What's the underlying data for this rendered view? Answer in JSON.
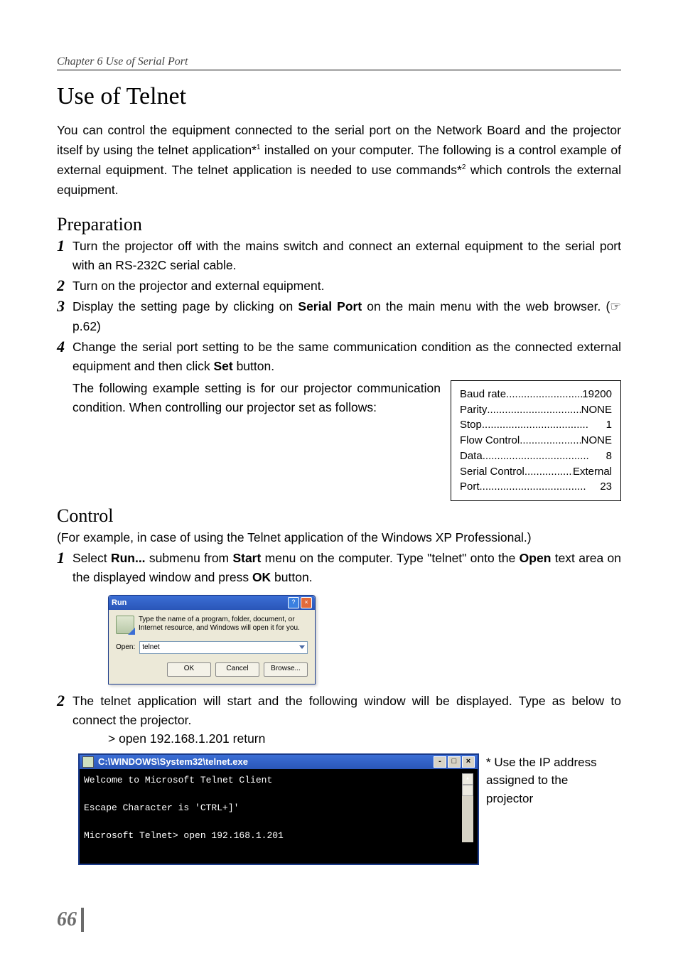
{
  "chapter_header": "Chapter 6 Use of Serial Port",
  "title": "Use of Telnet",
  "intro": {
    "p1a": "You can control the equipment connected to the serial port on the Network Board and the projector itself by using the telnet application*",
    "sup1": "1",
    "p1b": " installed on your computer. The following is a control example of external equipment. The telnet application is needed to use commands*",
    "sup2": "2",
    "p1c": " which controls the external equipment."
  },
  "prep_heading": "Preparation",
  "prep": {
    "s1": "Turn the projector off with the mains switch and connect an external equipment to the serial port with an RS-232C serial cable.",
    "s2": "Turn on the projector and external equipment.",
    "s3a": "Display the setting page by clicking on ",
    "s3b": "Serial Port",
    "s3c": " on the main menu with the web browser. (☞ p.62)",
    "s4a": "Change the serial port setting to be the same communication condition as the connected external equipment and then click ",
    "s4b": "Set",
    "s4c": " button.",
    "s4_follow": "The following example setting is for our projector communication condition. When controlling our projector set as follows:"
  },
  "settings": [
    {
      "k": "Baud rate",
      "v": "19200"
    },
    {
      "k": "Parity",
      "v": "NONE"
    },
    {
      "k": "Stop",
      "v": "1"
    },
    {
      "k": "Flow Control",
      "v": "NONE"
    },
    {
      "k": "Data",
      "v": "8"
    },
    {
      "k": "Serial Control",
      "v": "External"
    },
    {
      "k": "Port",
      "v": "23"
    }
  ],
  "control_heading": "Control",
  "control_note": "(For example, in case of using the Telnet application of the Windows XP Professional.)",
  "control": {
    "s1a": "Select ",
    "s1b": "Run...",
    "s1c": " submenu from ",
    "s1d": "Start",
    "s1e": " menu on the computer. Type \"telnet\" onto the ",
    "s1f": "Open",
    "s1g": " text area on the displayed window and press ",
    "s1h": "OK",
    "s1i": " button.",
    "s2": "The telnet application will start and the following window will be displayed. Type as below to connect the projector.",
    "cmd": "> open 192.168.1.201 return"
  },
  "run_dialog": {
    "title": "Run",
    "desc": "Type the name of a program, folder, document, or Internet resource, and Windows will open it for you.",
    "open_label": "Open:",
    "value": "telnet",
    "ok": "OK",
    "cancel": "Cancel",
    "browse": "Browse..."
  },
  "telnet": {
    "title": "C:\\WINDOWS\\System32\\telnet.exe",
    "line1": "Welcome to Microsoft Telnet Client",
    "line2": "Escape Character is 'CTRL+]'",
    "line3": "Microsoft Telnet> open 192.168.1.201"
  },
  "side_note": "* Use the IP address assigned to the projector",
  "page_number": "66"
}
